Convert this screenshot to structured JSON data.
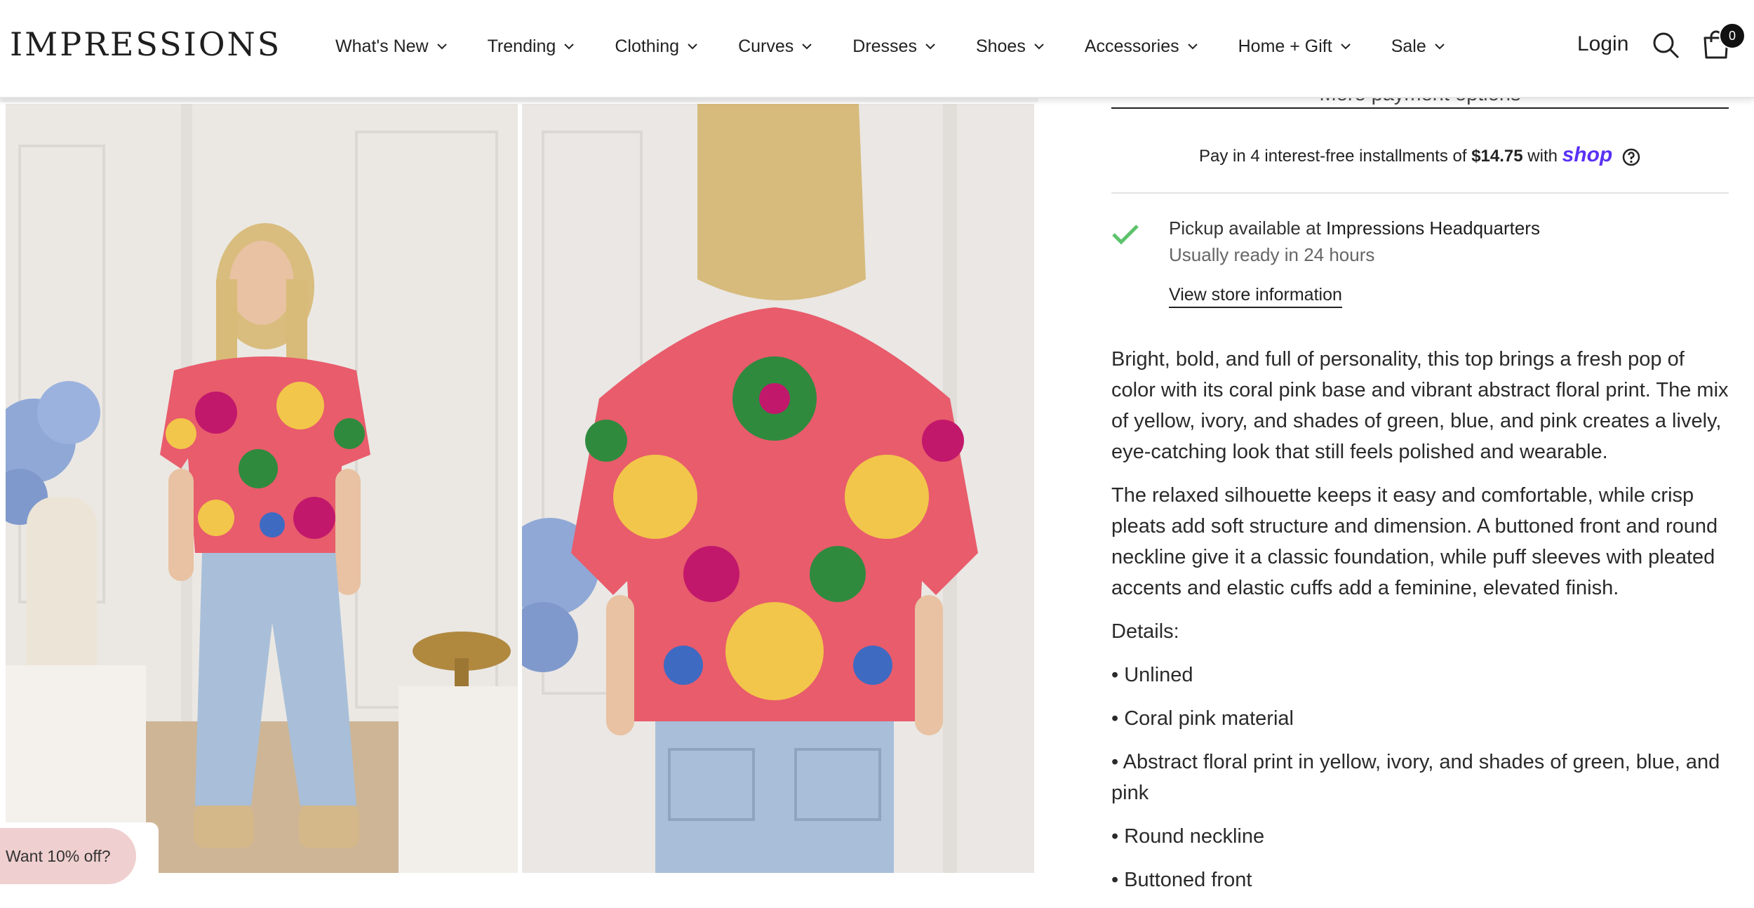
{
  "header": {
    "logo": "IMPRESSIONS",
    "nav": [
      {
        "label": "What's New"
      },
      {
        "label": "Trending"
      },
      {
        "label": "Clothing"
      },
      {
        "label": "Curves"
      },
      {
        "label": "Dresses"
      },
      {
        "label": "Shoes"
      },
      {
        "label": "Accessories"
      },
      {
        "label": "Home + Gift"
      },
      {
        "label": "Sale"
      }
    ],
    "login": "Login",
    "cart_count": "0"
  },
  "purchase": {
    "more_payment": "More payment options",
    "installments_prefix": "Pay in 4 interest-free installments of ",
    "installments_amount": "$14.75",
    "installments_with": " with ",
    "shop_brand": "shop"
  },
  "pickup": {
    "label_prefix": "Pickup available at ",
    "location": "Impressions Headquarters",
    "ready": "Usually ready in 24 hours",
    "store_link": "View store information"
  },
  "description": {
    "p1": "Bright, bold, and full of personality, this top brings a fresh pop of color with its coral pink base and vibrant abstract floral print. The mix of yellow, ivory, and shades of green, blue, and pink creates a lively, eye-catching look that still feels polished and wearable.",
    "p2": "The relaxed silhouette keeps it easy and comfortable, while crisp pleats add soft structure and dimension. A buttoned front and round neckline give it a classic foundation, while puff sleeves with pleated accents and elastic cuffs add a feminine, elevated finish.",
    "details_heading": "Details:",
    "bullets": [
      "• Unlined",
      "• Coral pink material",
      "• Abstract floral print in yellow, ivory, and shades of green, blue, and pink",
      "• Round neckline",
      "• Buttoned front"
    ]
  },
  "promo": {
    "label": "Want 10% off?"
  },
  "colors": {
    "shop_brand": "#5a31f4",
    "check": "#5cc36b",
    "promo_bg": "#efcfcf"
  },
  "icons": [
    "chevron-down-icon",
    "search-icon",
    "cart-icon",
    "help-circle-icon",
    "check-icon"
  ]
}
